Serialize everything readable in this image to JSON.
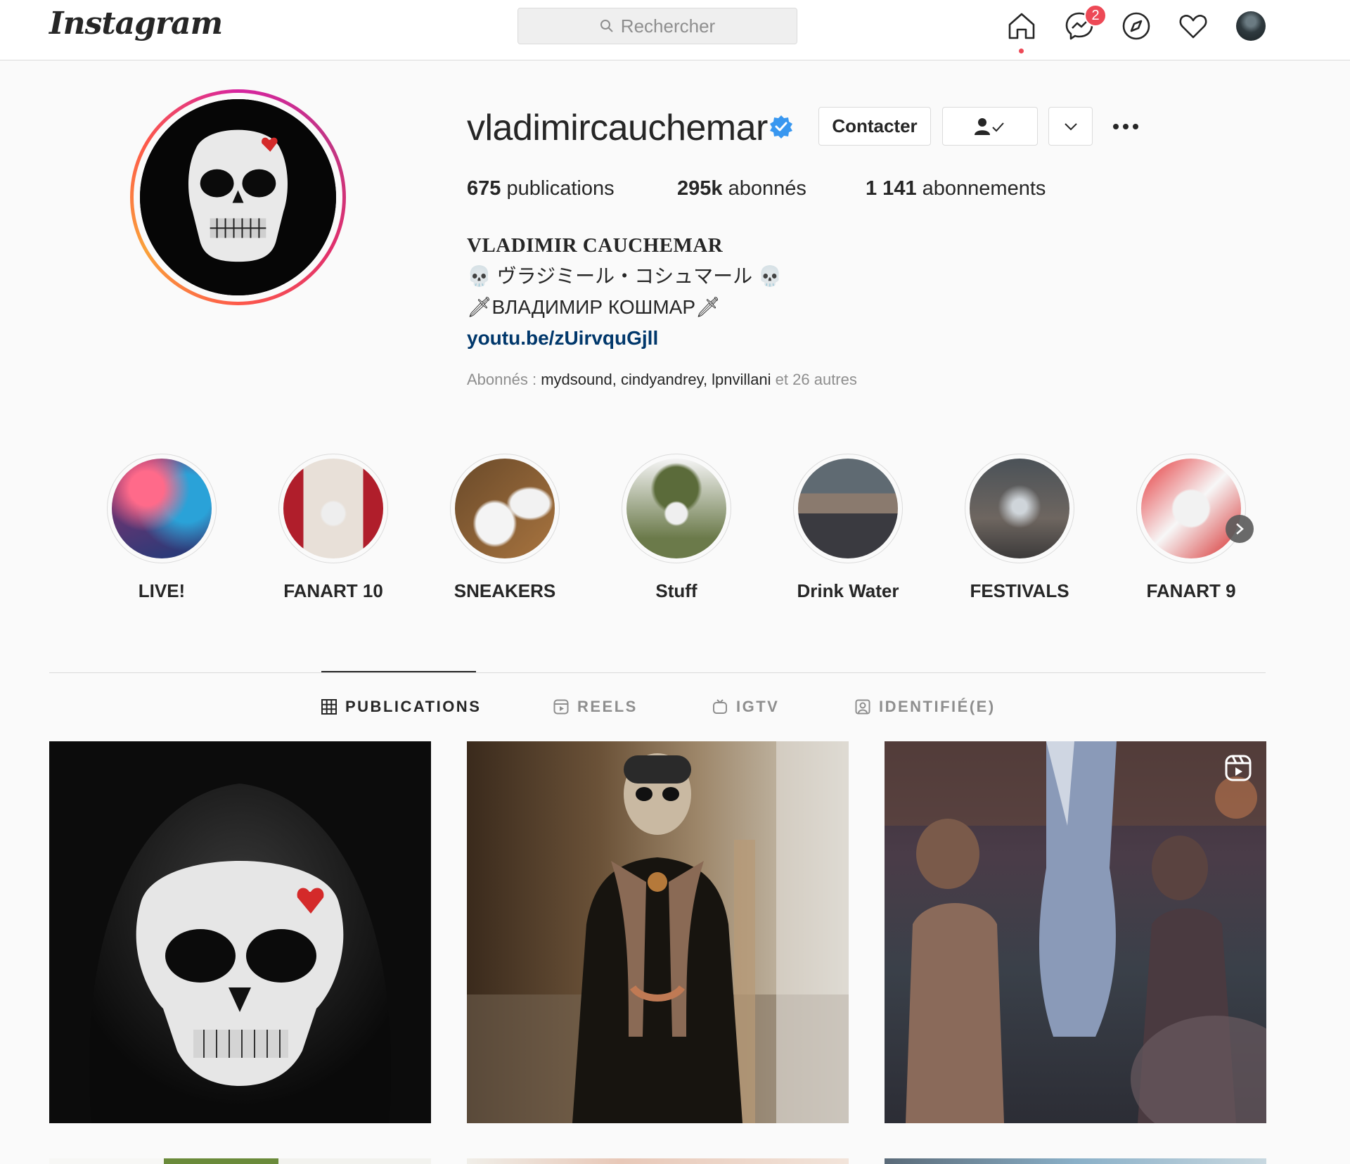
{
  "nav": {
    "logo": "Instagram",
    "search_placeholder": "Rechercher",
    "messages_badge": "2"
  },
  "profile": {
    "username": "vladimircauchemar",
    "verified": true,
    "buttons": {
      "contact": "Contacter"
    },
    "stats": {
      "posts_value": "675",
      "posts_label": " publications",
      "followers_value": "295k",
      "followers_label": " abonnés",
      "following_value": "1 141",
      "following_label": " abonnements"
    },
    "bio": {
      "name": "VLADIMIR CAUCHEMAR",
      "line1": "💀 ヴラジミール・コシュマール 💀",
      "line2": "🗡ВЛАДИМИР КОШМАР🗡",
      "link": "youtu.be/zUirvquGjll"
    },
    "followed_by": {
      "prefix": "Abonnés : ",
      "users": [
        "mydsound",
        "cindyandrey",
        "lpnvillani"
      ],
      "suffix": " et 26 autres"
    }
  },
  "highlights": [
    {
      "label": "LIVE!"
    },
    {
      "label": "FANART 10"
    },
    {
      "label": "SNEAKERS"
    },
    {
      "label": "Stuff"
    },
    {
      "label": "Drink Water"
    },
    {
      "label": "FESTIVALS"
    },
    {
      "label": "FANART 9"
    }
  ],
  "tabs": [
    {
      "label": "PUBLICATIONS",
      "active": true
    },
    {
      "label": "REELS",
      "active": false
    },
    {
      "label": "IGTV",
      "active": false
    },
    {
      "label": "IDENTIFIÉ(E)",
      "active": false
    }
  ],
  "colors": {
    "accent_link": "#00376b",
    "badge": "#ed4956",
    "verified": "#3897f0"
  }
}
